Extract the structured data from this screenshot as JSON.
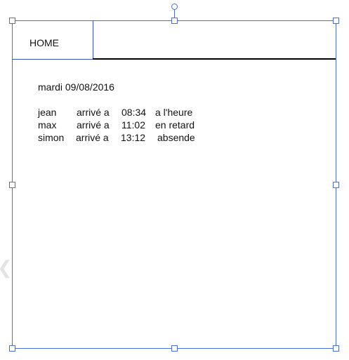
{
  "tab": {
    "label": "HOME"
  },
  "date": "mardi 09/08/2016",
  "rows": [
    {
      "name": "jean",
      "verb": "arrivé a",
      "time": "08:34",
      "status": "a l'heure"
    },
    {
      "name": "max",
      "verb": "arrivé a",
      "time": "11:02",
      "status": "en retard"
    },
    {
      "name": "simon",
      "verb": "arrivé a",
      "time": "13:12",
      "status": "absende"
    }
  ],
  "colors": {
    "selection": "#4a6fdc"
  }
}
